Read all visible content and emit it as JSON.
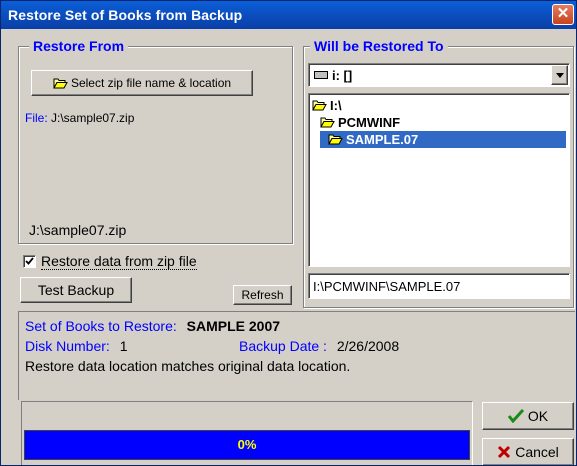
{
  "window": {
    "title": "Restore Set of Books from Backup",
    "close_glyph": "✕"
  },
  "restore_from": {
    "legend": "Restore From",
    "select_button": "Select zip file name & location",
    "file_label": "File:",
    "file_value": "J:\\sample07.zip",
    "zip_path": "J:\\sample07.zip",
    "checkbox_label": "Restore data from zip file",
    "checkbox_checked": true,
    "test_backup_button": "Test Backup",
    "refresh_button": "Refresh"
  },
  "restored_to": {
    "legend": "Will be Restored To",
    "drive_value": "i: []",
    "tree": [
      "I:\\",
      "PCMWINF",
      "SAMPLE.07"
    ],
    "selected_index": 2,
    "path_value": "I:\\PCMWINF\\SAMPLE.07"
  },
  "info": {
    "set_label": "Set of Books to Restore:",
    "set_value": "SAMPLE 2007",
    "disk_label": "Disk Number:",
    "disk_value": "1",
    "backup_date_label": "Backup Date :",
    "backup_date_value": "2/26/2008",
    "message": "Restore data location matches original data location."
  },
  "progress": {
    "text": "0%",
    "value": 0
  },
  "buttons": {
    "ok": "OK",
    "cancel": "Cancel"
  },
  "colors": {
    "accent": "#0000ff",
    "progress_bg": "#0000ff",
    "progress_text": "#ffff00",
    "selection": "#316ac5"
  },
  "icons": {
    "folder": "folder-open-icon",
    "drive": "drive-icon",
    "ok": "checkmark-icon",
    "cancel": "x-icon"
  }
}
